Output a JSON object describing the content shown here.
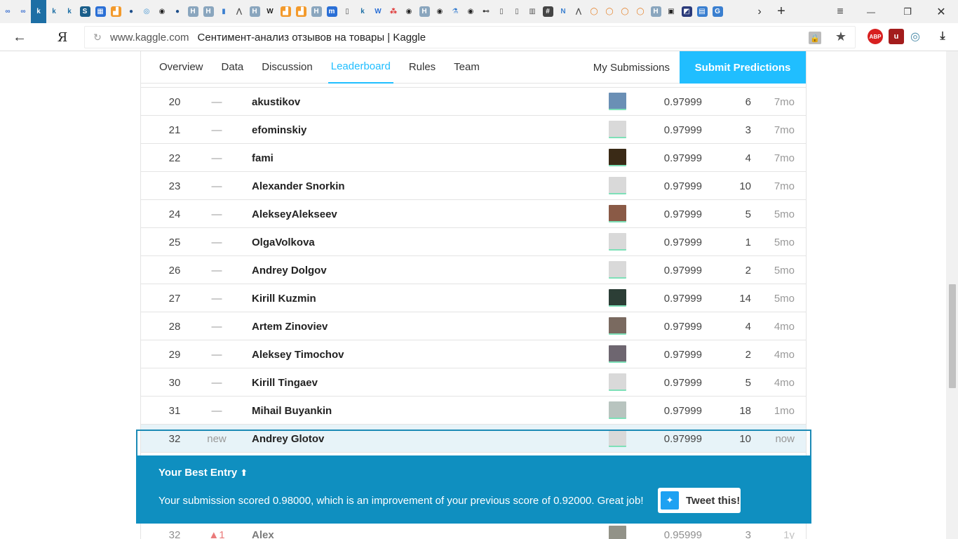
{
  "browser": {
    "url_host": "www.kaggle.com",
    "page_title": "Сентимент-анализ отзывов на товары | Kaggle",
    "back_icon": "←",
    "yandex_label": "Я",
    "tab_new_icon": "+",
    "tab_more_icon": "›",
    "window": {
      "menu": "≡",
      "minimize": "—",
      "restore": "❐",
      "close": "✕"
    },
    "extensions": [
      {
        "name": "adblock-icon",
        "label": "ABP",
        "color": "#d82020"
      },
      {
        "name": "ublock-icon",
        "label": "u",
        "color": "#a31c1c"
      },
      {
        "name": "aero-icon",
        "label": "◎",
        "color": "#4a8aa8"
      },
      {
        "name": "download-icon",
        "label": "⤓",
        "color": "#333333"
      }
    ]
  },
  "nav": {
    "tabs": [
      "Overview",
      "Data",
      "Discussion",
      "Leaderboard",
      "Rules",
      "Team"
    ],
    "active_tab": "Leaderboard",
    "my_submissions": "My Submissions",
    "submit": "Submit Predictions"
  },
  "leaderboard": {
    "rows": [
      {
        "rank": "20",
        "delta": "—",
        "team": "akustikov",
        "score": "0.97999",
        "entries": "6",
        "last": "7mo",
        "avatar_color": "#6a8fb5"
      },
      {
        "rank": "21",
        "delta": "—",
        "team": "efominskiy",
        "score": "0.97999",
        "entries": "3",
        "last": "7mo",
        "avatar_color": "#d9d9d9"
      },
      {
        "rank": "22",
        "delta": "—",
        "team": "fami",
        "score": "0.97999",
        "entries": "4",
        "last": "7mo",
        "avatar_color": "#3a2a16"
      },
      {
        "rank": "23",
        "delta": "—",
        "team": "Alexander Snorkin",
        "score": "0.97999",
        "entries": "10",
        "last": "7mo",
        "avatar_color": "#d9d9d9"
      },
      {
        "rank": "24",
        "delta": "—",
        "team": "AlekseyAlekseev",
        "score": "0.97999",
        "entries": "5",
        "last": "5mo",
        "avatar_color": "#8a5a46"
      },
      {
        "rank": "25",
        "delta": "—",
        "team": "OlgaVolkova",
        "score": "0.97999",
        "entries": "1",
        "last": "5mo",
        "avatar_color": "#d9d9d9"
      },
      {
        "rank": "26",
        "delta": "—",
        "team": "Andrey Dolgov",
        "score": "0.97999",
        "entries": "2",
        "last": "5mo",
        "avatar_color": "#d9d9d9"
      },
      {
        "rank": "27",
        "delta": "—",
        "team": "Kirill Kuzmin",
        "score": "0.97999",
        "entries": "14",
        "last": "5mo",
        "avatar_color": "#2c3e36"
      },
      {
        "rank": "28",
        "delta": "—",
        "team": "Artem Zinoviev",
        "score": "0.97999",
        "entries": "4",
        "last": "4mo",
        "avatar_color": "#7a6a60"
      },
      {
        "rank": "29",
        "delta": "—",
        "team": "Aleksey Timochov",
        "score": "0.97999",
        "entries": "2",
        "last": "4mo",
        "avatar_color": "#6e6670"
      },
      {
        "rank": "30",
        "delta": "—",
        "team": "Kirill Tingaev",
        "score": "0.97999",
        "entries": "5",
        "last": "4mo",
        "avatar_color": "#d9d9d9"
      },
      {
        "rank": "31",
        "delta": "—",
        "team": "Mihail Buyankin",
        "score": "0.97999",
        "entries": "18",
        "last": "1mo",
        "avatar_color": "#b8c4bf"
      },
      {
        "rank": "32",
        "delta": "new",
        "team": "Andrey Glotov",
        "score": "0.97999",
        "entries": "10",
        "last": "now",
        "avatar_color": "#d9d9d9",
        "you": true
      }
    ],
    "after_row": {
      "rank": "32",
      "delta": "▲1",
      "team": "Alex",
      "score": "0.95999",
      "entries": "3",
      "last": "1y",
      "avatar_color": "#4a4a3a"
    }
  },
  "best_entry": {
    "title": "Your Best Entry",
    "arrow_icon": "🡅",
    "message": "Your submission scored 0.98000, which is an improvement of your previous score of 0.92000. Great job!",
    "tweet_label": "Tweet this!",
    "tweet_icon": "🐦"
  },
  "colors": {
    "accent": "#20beff",
    "banner": "#0f8fc0",
    "highlight_row": "#e7f3f8"
  }
}
